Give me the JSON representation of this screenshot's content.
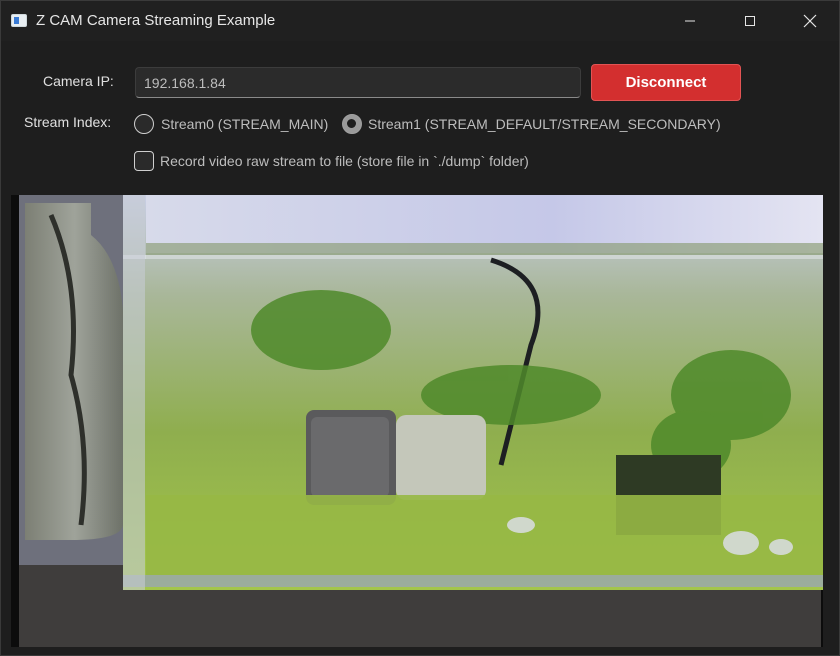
{
  "window": {
    "title": "Z CAM Camera Streaming Example",
    "icon": "app-window-icon",
    "controls": [
      "minimize-icon",
      "maximize-icon",
      "close-icon"
    ]
  },
  "connection": {
    "ip_label": "Camera IP:",
    "ip_value": "192.168.1.84",
    "button_label": "Disconnect",
    "button_color": "#d32f2f"
  },
  "stream": {
    "label": "Stream Index:",
    "options": [
      {
        "label": "Stream0 (STREAM_MAIN)",
        "selected": false
      },
      {
        "label": "Stream1 (STREAM_DEFAULT/STREAM_SECONDARY)",
        "selected": true
      }
    ]
  },
  "record": {
    "label": "Record video raw stream to file (store file in `./dump` folder)",
    "checked": false
  },
  "video": {
    "content": "live-camera-preview"
  },
  "colors": {
    "background": "#1e1e1e",
    "accent": "#d32f2f"
  }
}
